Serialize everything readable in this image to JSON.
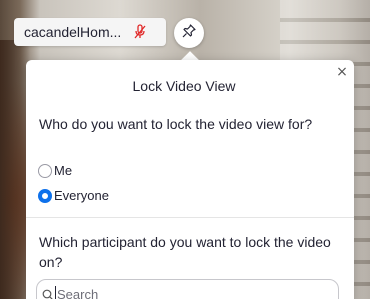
{
  "video_tile": {
    "participant_name": "cacandelHom...",
    "mic_icon": "mic-muted-icon",
    "pin_icon": "pin-icon"
  },
  "popover": {
    "title": "Lock Video View",
    "close_icon": "close-icon",
    "close_glyph": "×",
    "question_lock_for": "Who do you want to lock the video view for?",
    "options": [
      {
        "label": "Me",
        "selected": false
      },
      {
        "label": "Everyone",
        "selected": true
      }
    ],
    "question_participant": "Which participant do you want to lock the video on?",
    "search": {
      "placeholder": "Search",
      "value": ""
    }
  },
  "colors": {
    "accent": "#0e71eb",
    "muted_mic": "#e02828",
    "text": "#232333"
  }
}
